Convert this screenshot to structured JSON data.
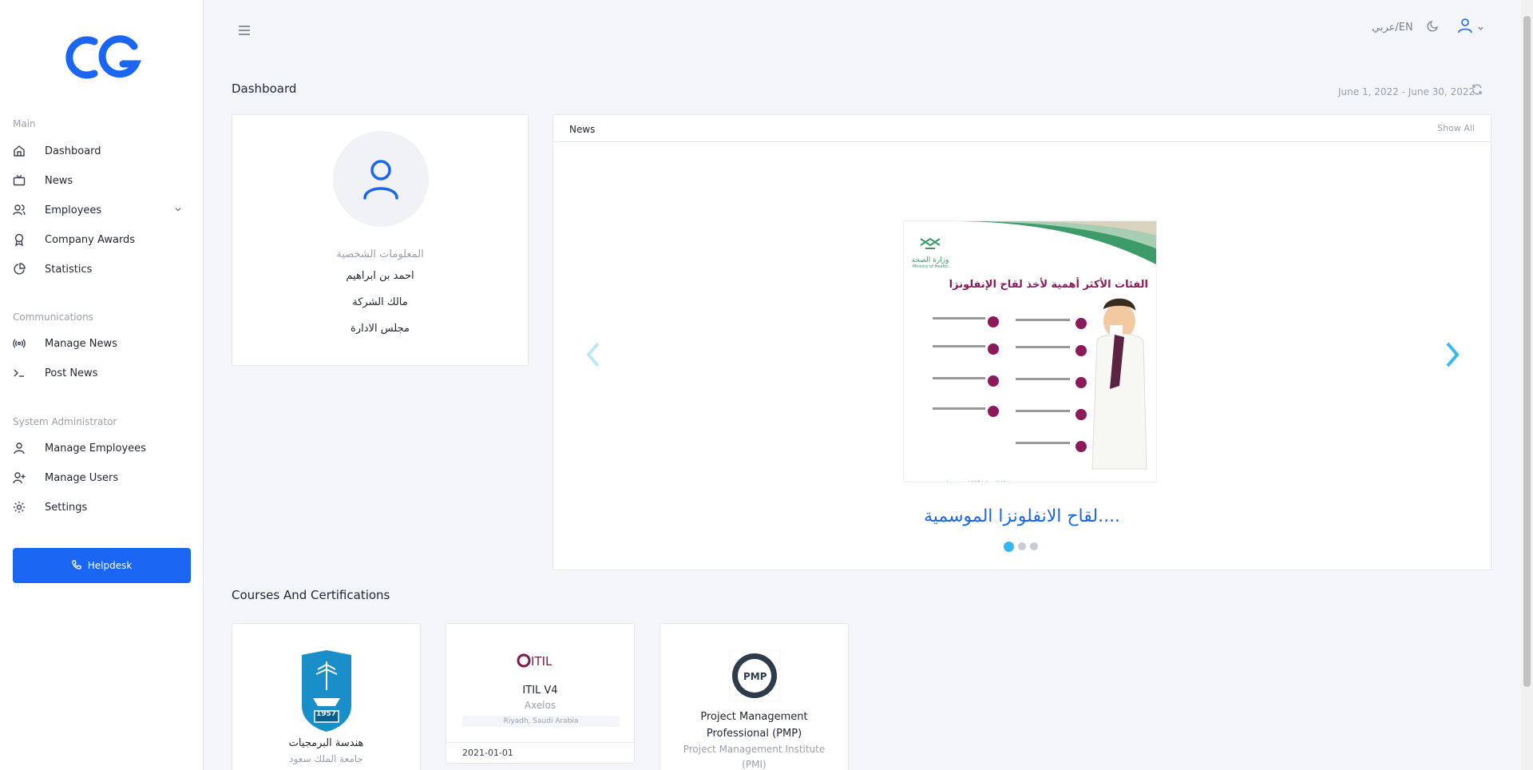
{
  "logo": {
    "text": "CG",
    "color": "#1a66f2"
  },
  "sidebar": {
    "sections": [
      {
        "label": "Main"
      },
      {
        "label": "Communications"
      },
      {
        "label": "System Administrator"
      }
    ],
    "items": [
      {
        "label": "Dashboard",
        "icon": "home-icon"
      },
      {
        "label": "News",
        "icon": "tv-icon"
      },
      {
        "label": "Employees",
        "icon": "users-icon"
      },
      {
        "label": "Company Awards",
        "icon": "award-icon"
      },
      {
        "label": "Statistics",
        "icon": "pie-chart-icon"
      },
      {
        "label": "Manage News",
        "icon": "broadcast-icon"
      },
      {
        "label": "Post News",
        "icon": "terminal-icon"
      },
      {
        "label": "Manage Employees",
        "icon": "user-icon"
      },
      {
        "label": "Manage Users",
        "icon": "user-plus-icon"
      },
      {
        "label": "Settings",
        "icon": "gear-icon"
      }
    ],
    "helpdesk": "Helpdesk"
  },
  "topbar": {
    "lang": "عربي/EN"
  },
  "page": {
    "title": "Dashboard",
    "daterange": "June 1, 2022 - June 30, 2022"
  },
  "profile": {
    "label": "المعلومات الشخصية",
    "name": "احمد بن ابراهيم",
    "role": "مالك الشركة",
    "board": "مجلس الادارة"
  },
  "news": {
    "title": "News",
    "show_all": "Show All",
    "caption": "....لقاح الانفلونزا الموسمية",
    "slide_title": "الفئات الأكثر أهمية لأخذ لقاح الإنفلونزا",
    "ministry": "وزارة الصحة",
    "ministry_en": "Ministry of Health",
    "slides_count": 3,
    "active_slide": 1
  },
  "courses": {
    "title": "Courses And Certifications",
    "items": [
      {
        "name": "هندسة البرمجيات",
        "org": "جامعة الملك سعود",
        "badge": "1957"
      },
      {
        "name": "ITIL V4",
        "org": "Axelos",
        "location": "Riyadh, Saudi Arabia",
        "date": "2021-01-01",
        "logo": "ITIL"
      },
      {
        "name": "Project Management Professional (PMP)",
        "org": "Project Management Institute (PMI)",
        "logo": "PMP"
      }
    ]
  },
  "colors": {
    "accent": "#1a66f2",
    "carousel_arrow": "#35b8f2",
    "infographic": "#8c1a5b"
  }
}
